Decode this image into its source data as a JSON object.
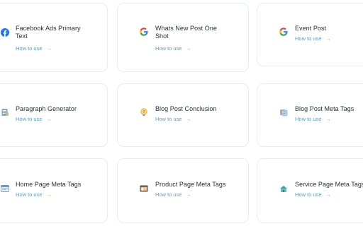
{
  "cards": [
    {
      "title_line1": "Facebook Ads Primary",
      "title_line2": "Text",
      "link": "How to use",
      "arrow": "→",
      "icon": "facebook-icon"
    },
    {
      "title_line1": "Whats New Post One",
      "title_line2": "Shot",
      "link": "How to use",
      "arrow": "→",
      "icon": "google-icon"
    },
    {
      "title_line1": "Event Post",
      "title_line2": "",
      "link": "How to use",
      "arrow": "→",
      "icon": "google-icon"
    },
    {
      "title_line1": "Paragraph Generator",
      "title_line2": "",
      "link": "How to use",
      "arrow": "→",
      "icon": "document-icon"
    },
    {
      "title_line1": "Blog Post Conclusion",
      "title_line2": "",
      "link": "How to use",
      "arrow": "→",
      "icon": "lightbulb-icon"
    },
    {
      "title_line1": "Blog Post Meta Tags",
      "title_line2": "",
      "link": "How to use",
      "arrow": "→",
      "icon": "tags-icon"
    },
    {
      "title_line1": "Home Page Meta Tags",
      "title_line2": "",
      "link": "How to use",
      "arrow": "→",
      "icon": "webpage-icon"
    },
    {
      "title_line1": "Product Page Meta Tags",
      "title_line2": "",
      "link": "How to use",
      "arrow": "→",
      "icon": "product-page-icon"
    },
    {
      "title_line1": "Service Page Meta Tags",
      "title_line2": "",
      "link": "How to use",
      "arrow": "→",
      "icon": "service-page-icon"
    }
  ],
  "colors": {
    "link": "#5d9bd3",
    "arrow": "#5fb46a",
    "title": "#2b2f36",
    "card_border": "#e9ecef",
    "facebook": "#1877f2"
  }
}
